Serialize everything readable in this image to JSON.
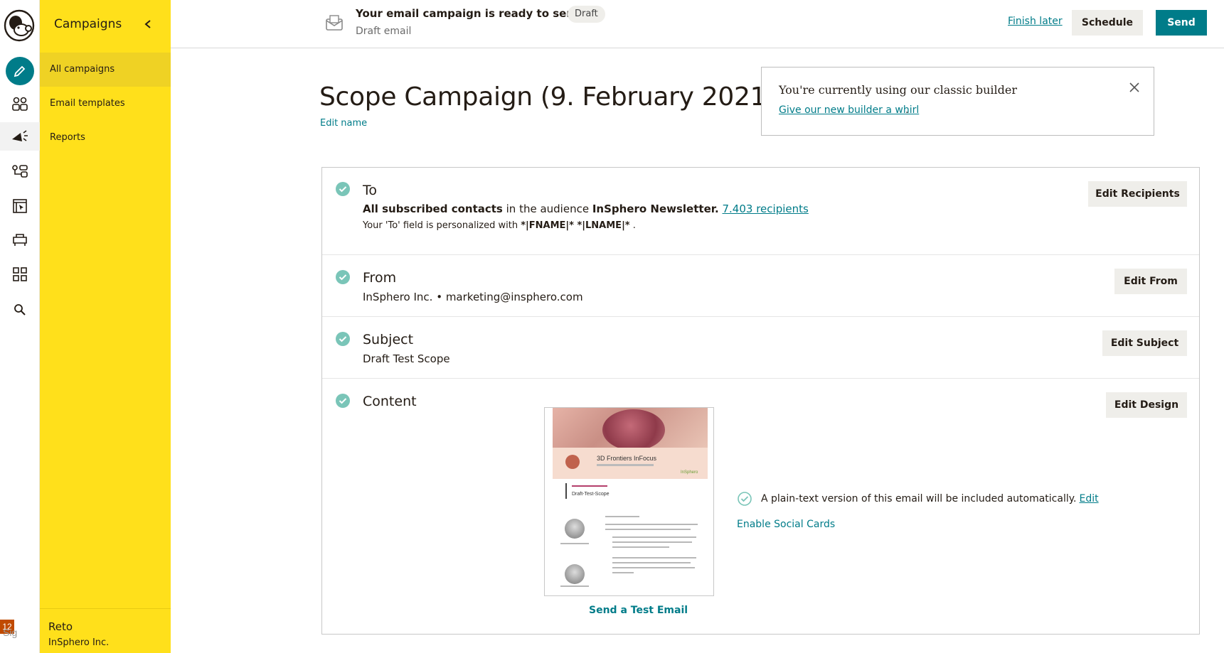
{
  "rail": {
    "icons": [
      "mailchimp-logo",
      "create-icon",
      "audience-icon",
      "campaigns-icon",
      "automations-icon",
      "website-icon",
      "content-icon",
      "integrations-icon",
      "search-icon"
    ],
    "notification_count": "12",
    "signature_alt": "Sig"
  },
  "nav": {
    "title": "Campaigns",
    "items": [
      {
        "label": "All campaigns",
        "selected": true
      },
      {
        "label": "Email templates",
        "selected": false
      },
      {
        "label": "Reports",
        "selected": false
      }
    ],
    "user": {
      "name": "Reto",
      "org": "InSphero Inc."
    }
  },
  "topbar": {
    "status_title": "Your email campaign is ready to send!",
    "status_pill": "Draft",
    "subtitle": "Draft email",
    "finish_later": "Finish later",
    "schedule": "Schedule",
    "send": "Send"
  },
  "campaign": {
    "title": "Scope Campaign (9. February 2021)",
    "edit_name": "Edit name"
  },
  "notice": {
    "text": "You're currently using our classic builder",
    "link": "Give our new builder a whirl",
    "period": "."
  },
  "checklist": {
    "to": {
      "title": "To",
      "line_bold1": "All subscribed contacts",
      "line_mid": " in the audience ",
      "line_bold2": "InSphero Newsletter.",
      "recipients_link": "7.403 recipients",
      "personalized_prefix": "Your 'To' field is personalized with ",
      "personalized_tags": "*|FNAME|* *|LNAME|*",
      "personalized_suffix": " .",
      "button": "Edit Recipients"
    },
    "from": {
      "title": "From",
      "value": "InSphero Inc. • marketing@insphero.com",
      "button": "Edit From"
    },
    "subject": {
      "title": "Subject",
      "value": "Draft Test Scope",
      "button": "Edit Subject"
    },
    "content": {
      "title": "Content",
      "button": "Edit Design",
      "preview_title": "3D Frontiers InFocus",
      "preview_draft": "Draft-Test-Scope",
      "preview_logo": "InSphero",
      "send_test": "Send a Test Email",
      "plain_text": "A plain-text version of this email will be included automatically.",
      "plain_edit": "Edit",
      "social_cards": "Enable Social Cards"
    }
  },
  "colors": {
    "accent": "#007c89",
    "nav_bg": "#ffe01b",
    "check": "#7ac5b8"
  }
}
